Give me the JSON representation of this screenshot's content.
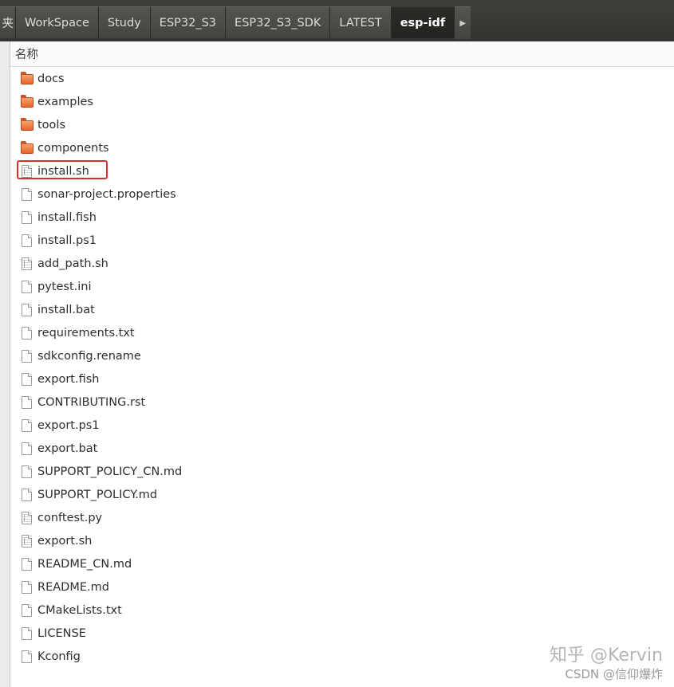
{
  "breadcrumb": {
    "items": [
      {
        "label": "夹",
        "id": "prev"
      },
      {
        "label": "WorkSpace",
        "id": "workspace"
      },
      {
        "label": "Study",
        "id": "study"
      },
      {
        "label": "ESP32_S3",
        "id": "esp32-s3"
      },
      {
        "label": "ESP32_S3_SDK",
        "id": "esp32-s3-sdk"
      },
      {
        "label": "LATEST",
        "id": "latest"
      },
      {
        "label": "esp-idf",
        "id": "esp-idf"
      }
    ],
    "active": "esp-idf",
    "next_icon": "chevron-right-icon"
  },
  "list": {
    "column_header": "名称",
    "highlighted": "install.sh",
    "highlight_color": "#d4332e",
    "items": [
      {
        "name": "docs",
        "type": "folder"
      },
      {
        "name": "examples",
        "type": "folder"
      },
      {
        "name": "tools",
        "type": "folder"
      },
      {
        "name": "components",
        "type": "folder"
      },
      {
        "name": "install.sh",
        "type": "script"
      },
      {
        "name": "sonar-project.properties",
        "type": "file"
      },
      {
        "name": "install.fish",
        "type": "file"
      },
      {
        "name": "install.ps1",
        "type": "file"
      },
      {
        "name": "add_path.sh",
        "type": "script"
      },
      {
        "name": "pytest.ini",
        "type": "file"
      },
      {
        "name": "install.bat",
        "type": "file"
      },
      {
        "name": "requirements.txt",
        "type": "file"
      },
      {
        "name": "sdkconfig.rename",
        "type": "file"
      },
      {
        "name": "export.fish",
        "type": "file"
      },
      {
        "name": "CONTRIBUTING.rst",
        "type": "file"
      },
      {
        "name": "export.ps1",
        "type": "file"
      },
      {
        "name": "export.bat",
        "type": "file"
      },
      {
        "name": "SUPPORT_POLICY_CN.md",
        "type": "file"
      },
      {
        "name": "SUPPORT_POLICY.md",
        "type": "file"
      },
      {
        "name": "conftest.py",
        "type": "script"
      },
      {
        "name": "export.sh",
        "type": "script"
      },
      {
        "name": "README_CN.md",
        "type": "file"
      },
      {
        "name": "README.md",
        "type": "file"
      },
      {
        "name": "CMakeLists.txt",
        "type": "file"
      },
      {
        "name": "LICENSE",
        "type": "file"
      },
      {
        "name": "Kconfig",
        "type": "file"
      }
    ]
  },
  "watermark": {
    "line1": "知乎 @Kervin",
    "line2": "CSDN @信仰爆炸"
  },
  "colors": {
    "pathbar": "#3b3a36",
    "active_crumb": "#262522",
    "folder": "#e9632e"
  }
}
